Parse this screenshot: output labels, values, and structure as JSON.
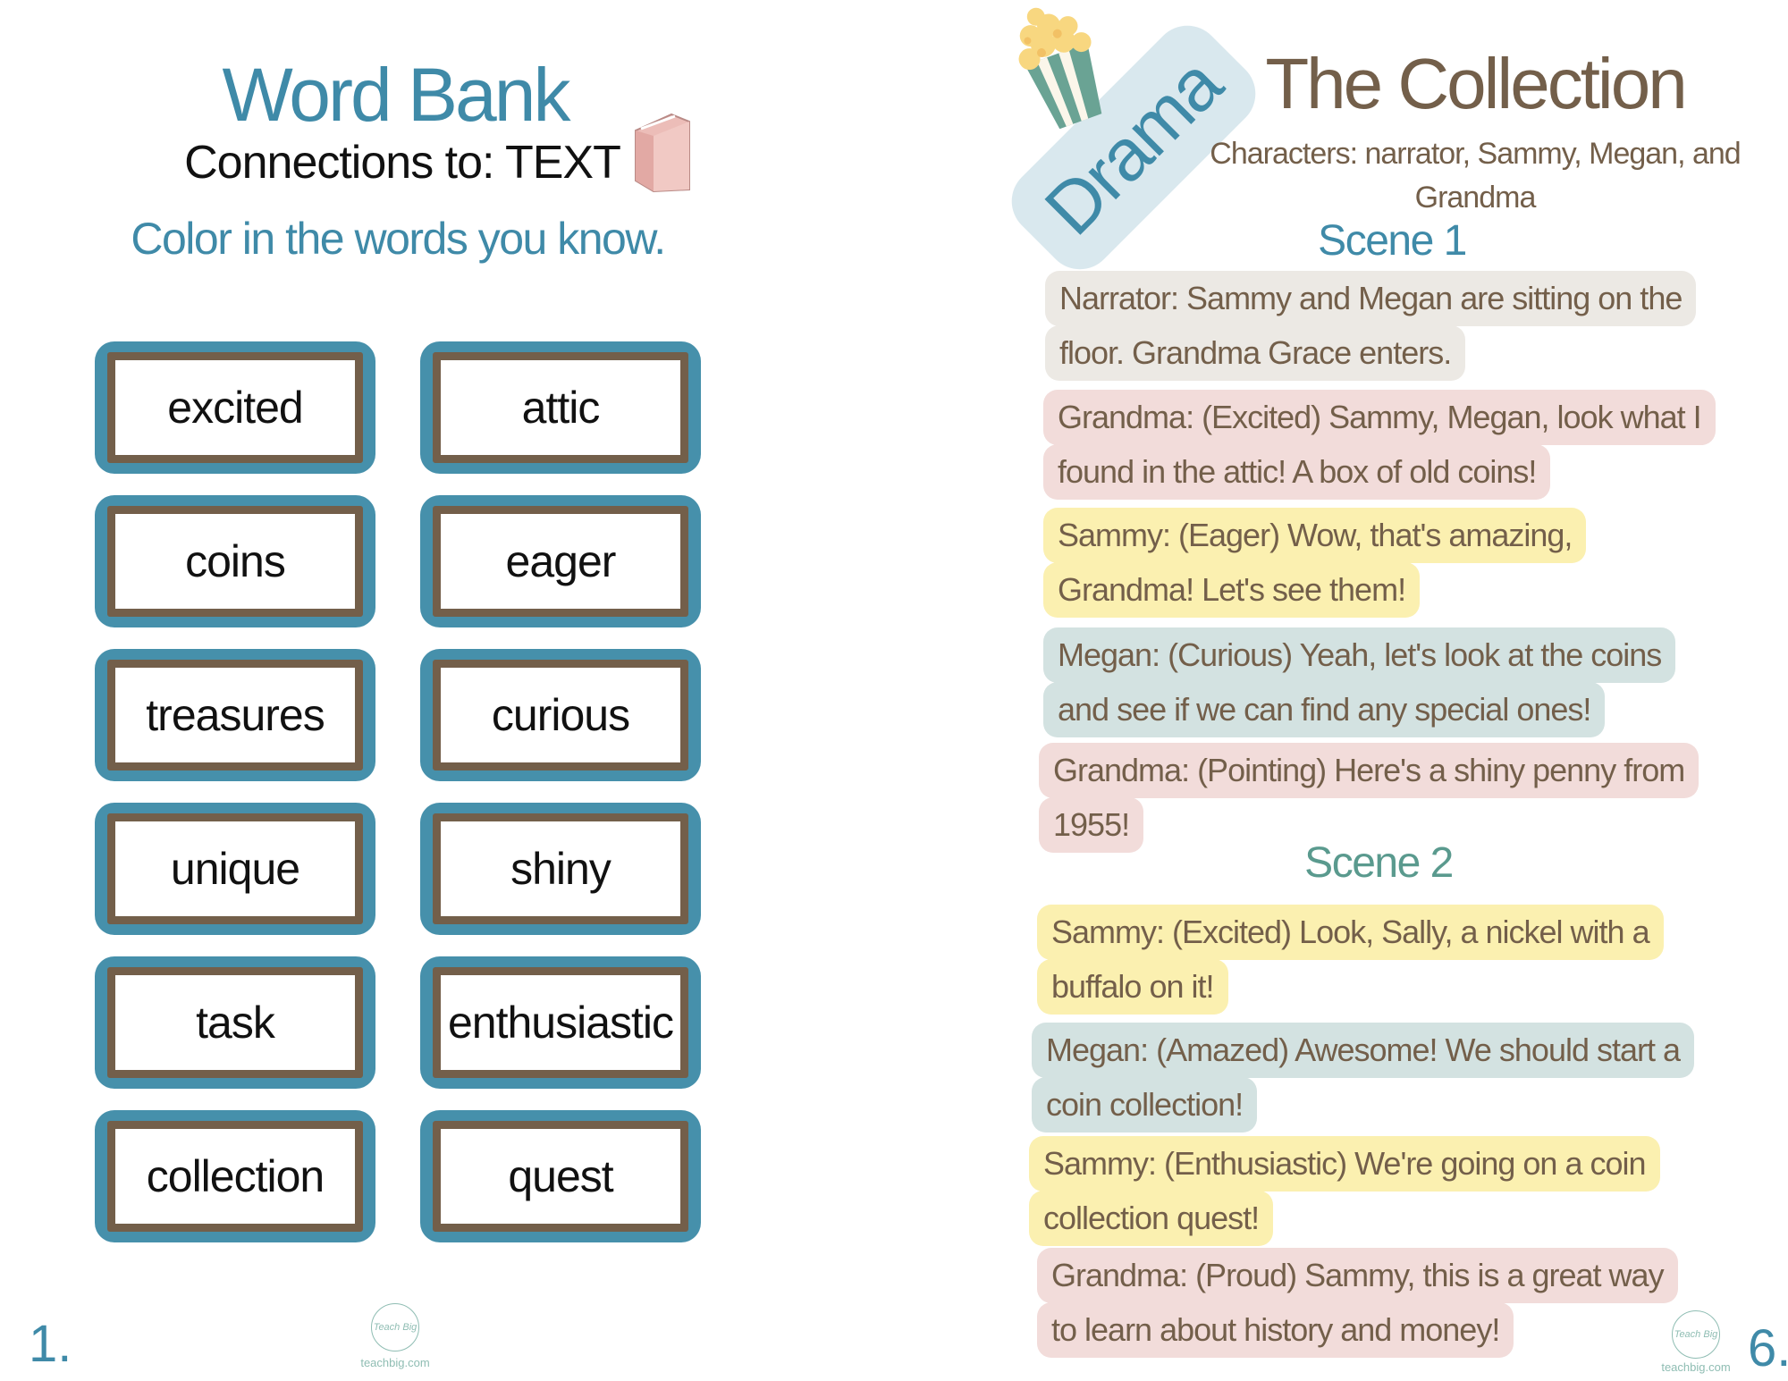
{
  "left_page": {
    "title": "Word Bank",
    "subtitle": "Connections to:  TEXT",
    "instruction": "Color in the words you know.",
    "words": [
      "excited",
      "attic",
      "coins",
      "eager",
      "treasures",
      "curious",
      "unique",
      "shiny",
      "task",
      "enthusiastic",
      "collection",
      "quest"
    ],
    "page_number": "1.",
    "logo_text": "Teach Big",
    "logo_url": "teachbig.com",
    "colors": {
      "accent_blue": "#3f8aa8",
      "box_border": "#4690ab",
      "box_frame": "#735f4a"
    },
    "icon": "book-icon"
  },
  "right_page": {
    "badge": "Drama",
    "icon": "popcorn-icon",
    "title": "The Collection",
    "characters_line1": "Characters: narrator, Sammy, Megan, and",
    "characters_line2": "Grandma",
    "scene1": "Scene 1",
    "scene2": "Scene 2",
    "scene1_lines": [
      {
        "speaker": "narrator",
        "color": "#ece9e4",
        "lines": [
          "Narrator: Sammy and Megan are sitting on the",
          "floor. Grandma Grace enters."
        ]
      },
      {
        "speaker": "grandma",
        "color": "#f2dcda",
        "lines": [
          "Grandma: (Excited) Sammy, Megan, look what I",
          "found in the attic! A box of old coins!"
        ]
      },
      {
        "speaker": "sammy",
        "color": "#fbf0b0",
        "lines": [
          "Sammy: (Eager) Wow, that's amazing,",
          "Grandma! Let's see them!"
        ]
      },
      {
        "speaker": "megan",
        "color": "#d3e2e1",
        "lines": [
          "Megan: (Curious) Yeah, let's look at the coins",
          "and see if we can find any special ones!"
        ]
      },
      {
        "speaker": "grandma",
        "color": "#f2dcda",
        "lines": [
          "Grandma: (Pointing) Here's a shiny penny from",
          "1955!"
        ]
      }
    ],
    "scene2_lines": [
      {
        "speaker": "sammy",
        "color": "#fbf0b0",
        "lines": [
          "Sammy: (Excited) Look, Sally, a nickel with a",
          "buffalo on it!"
        ]
      },
      {
        "speaker": "megan",
        "color": "#d3e2e1",
        "lines": [
          "Megan: (Amazed) Awesome! We should start a",
          "coin collection!"
        ]
      },
      {
        "speaker": "sammy",
        "color": "#fbf0b0",
        "lines": [
          "Sammy: (Enthusiastic) We're going on a coin",
          "collection quest!"
        ]
      },
      {
        "speaker": "grandma",
        "color": "#f2dcda",
        "lines": [
          "Grandma: (Proud) Sammy, this is a great way",
          "to learn about history and money!"
        ]
      }
    ],
    "page_number": "6.",
    "logo_text": "Teach Big",
    "logo_url": "teachbig.com",
    "colors": {
      "title_brown": "#735f4a",
      "scene1_blue": "#3f8aa8",
      "scene2_teal": "#5a9a8e",
      "badge_bg": "#d9e8ee"
    }
  }
}
